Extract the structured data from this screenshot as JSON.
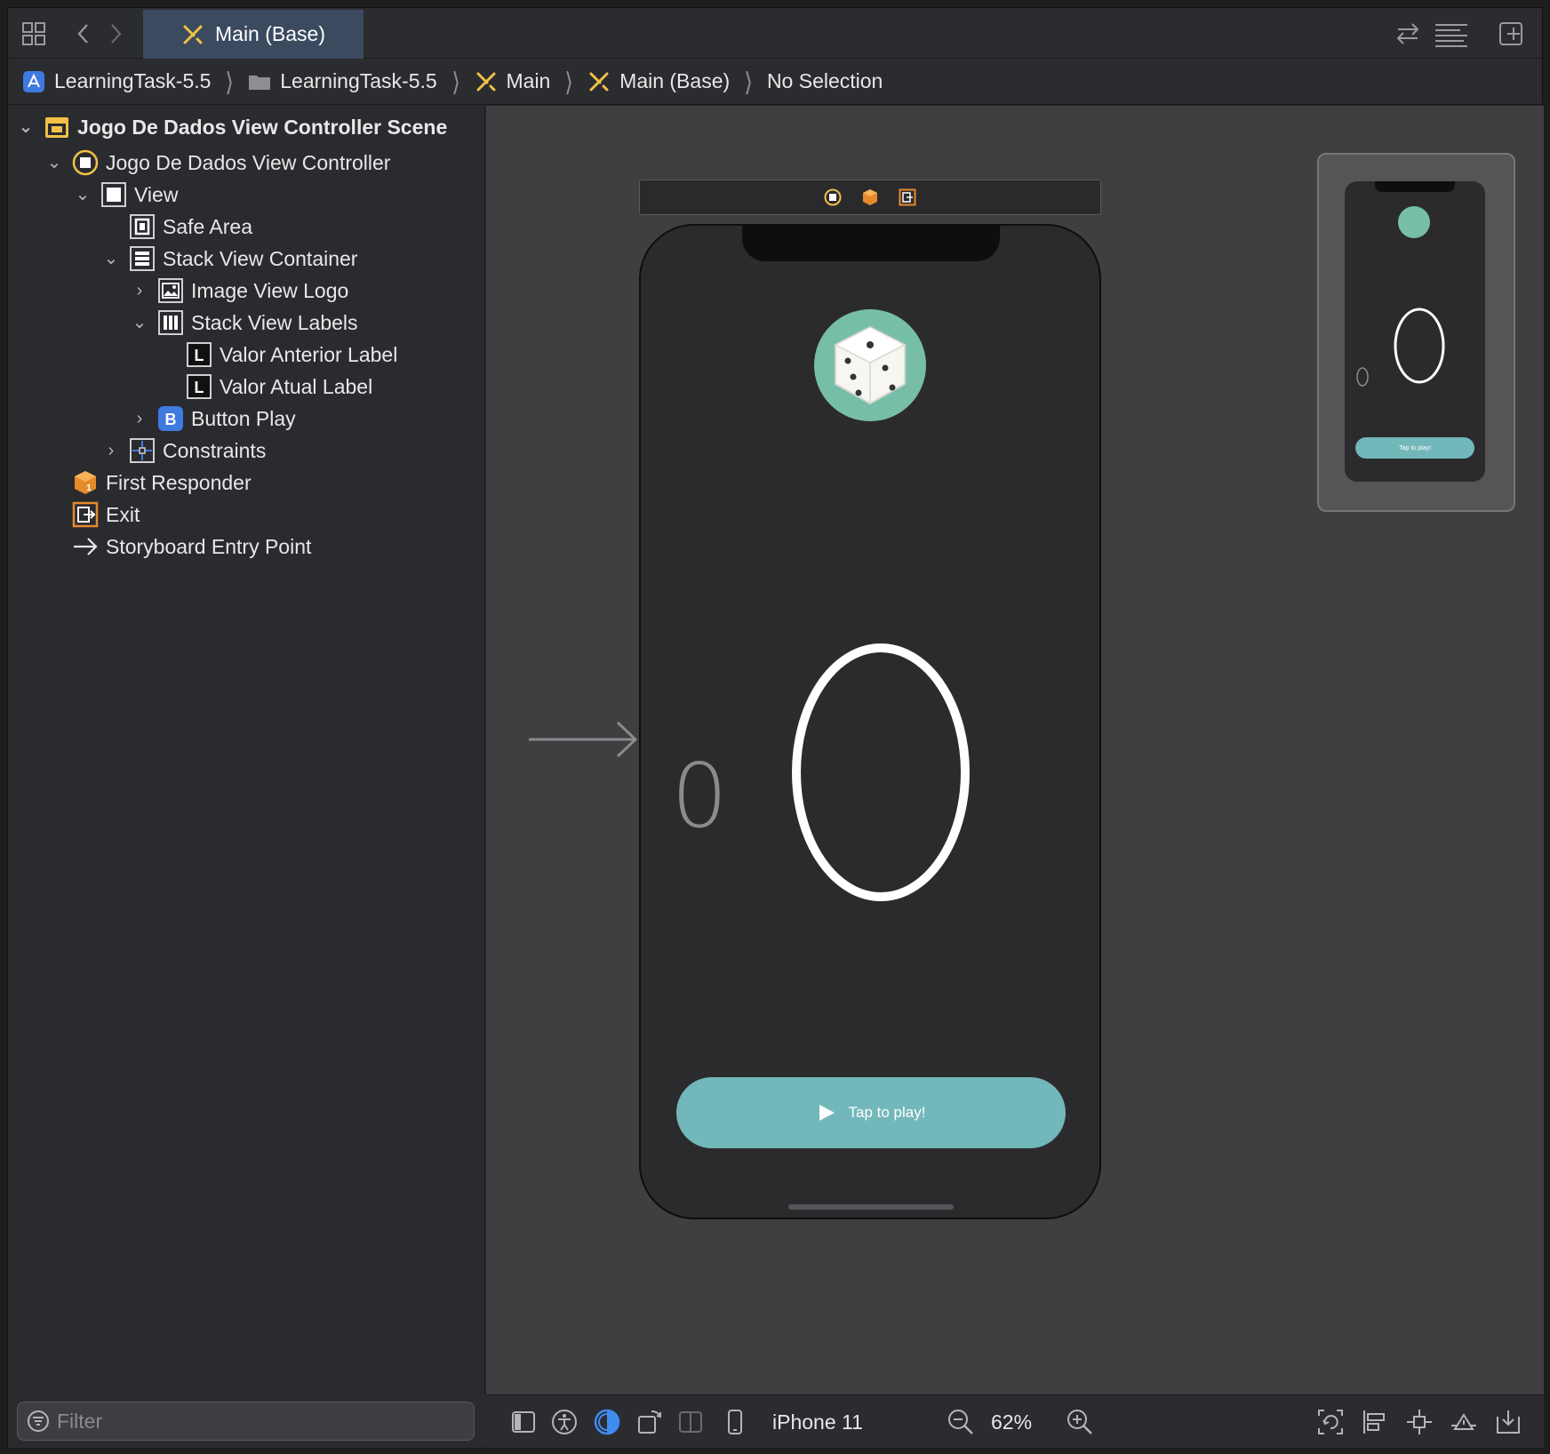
{
  "tabbar": {
    "active_tab": "Main (Base)",
    "icons": [
      "grid-icon",
      "back-chevron-icon",
      "forward-chevron-icon",
      "swap-arrows-icon",
      "minimap-lines-icon",
      "add-editor-icon"
    ]
  },
  "jumpbar": {
    "crumbs": [
      "LearningTask-5.5",
      "LearningTask-5.5",
      "Main",
      "Main (Base)",
      "No Selection"
    ]
  },
  "outline": {
    "scene": "Jogo De Dados View Controller Scene",
    "controller": "Jogo De Dados View Controller",
    "view": "View",
    "safe_area": "Safe Area",
    "stack_container": "Stack View Container",
    "image_view_logo": "Image View Logo",
    "stack_labels": "Stack View Labels",
    "valor_anterior": "Valor Anterior Label",
    "valor_atual": "Valor Atual Label",
    "button_play": "Button Play",
    "constraints": "Constraints",
    "first_responder": "First Responder",
    "exit": "Exit",
    "entry_point": "Storyboard Entry Point",
    "filter_placeholder": "Filter"
  },
  "canvas": {
    "previous_value": "0",
    "current_value": "0",
    "play_button_label": "Tap to play!",
    "accent_color": "#72b7b9",
    "logo_color": "#77bea9"
  },
  "bottombar": {
    "device": "iPhone 11",
    "zoom": "62%"
  }
}
